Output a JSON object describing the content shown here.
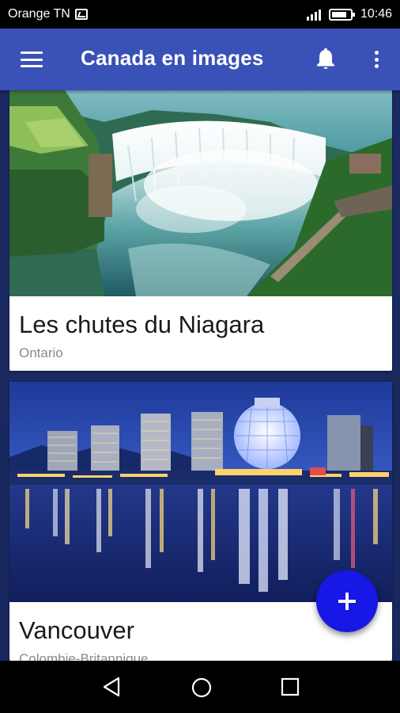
{
  "status_bar": {
    "carrier": "Orange TN",
    "time": "10:46",
    "icons": [
      "image-icon",
      "signal-icon",
      "battery-icon"
    ]
  },
  "app_bar": {
    "title": "Canada en images",
    "background": "#3a51b8",
    "icons": [
      "hamburger-menu-icon",
      "bell-icon",
      "more-vert-icon"
    ]
  },
  "cards": [
    {
      "title": "Les chutes du Niagara",
      "subtitle": "Ontario",
      "image": "niagara-falls-photo"
    },
    {
      "title": "Vancouver",
      "subtitle": "Colombie-Britannique",
      "image": "vancouver-skyline-photo"
    }
  ],
  "fab": {
    "icon": "plus-icon",
    "color": "#1717e6"
  },
  "nav_bar": {
    "icons": [
      "back-icon",
      "home-icon",
      "recent-apps-icon"
    ]
  }
}
